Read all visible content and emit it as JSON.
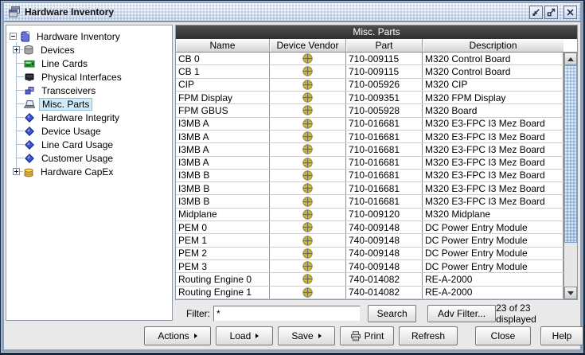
{
  "window": {
    "title": "Hardware Inventory",
    "controls": [
      {
        "name": "minimize"
      },
      {
        "name": "maximize"
      },
      {
        "name": "close"
      }
    ]
  },
  "tree": {
    "items": [
      {
        "label": "Hardware Inventory",
        "icon": "notebook-icon",
        "expander": "minus",
        "level": 0,
        "selected": false
      },
      {
        "label": "Devices",
        "icon": "devices-icon",
        "expander": "plus",
        "level": 1,
        "selected": false
      },
      {
        "label": "Line Cards",
        "icon": "line-card-icon",
        "expander": null,
        "level": 1,
        "selected": false
      },
      {
        "label": "Physical Interfaces",
        "icon": "physical-interface-icon",
        "expander": null,
        "level": 1,
        "selected": false
      },
      {
        "label": "Transceivers",
        "icon": "transceiver-icon",
        "expander": null,
        "level": 1,
        "selected": false
      },
      {
        "label": "Misc. Parts",
        "icon": "laptop-icon",
        "expander": null,
        "level": 1,
        "selected": true
      },
      {
        "label": "Hardware Integrity",
        "icon": "diamond-icon",
        "expander": null,
        "level": 1,
        "selected": false
      },
      {
        "label": "Device Usage",
        "icon": "diamond-icon",
        "expander": null,
        "level": 1,
        "selected": false
      },
      {
        "label": "Line Card Usage",
        "icon": "diamond-icon",
        "expander": null,
        "level": 1,
        "selected": false
      },
      {
        "label": "Customer Usage",
        "icon": "diamond-icon",
        "expander": null,
        "level": 1,
        "selected": false
      },
      {
        "label": "Hardware CapEx",
        "icon": "coins-icon",
        "expander": "plus",
        "level": 1,
        "selected": false
      }
    ]
  },
  "table": {
    "title": "Misc. Parts",
    "columns": [
      "Name",
      "Device Vendor",
      "Part",
      "Description"
    ],
    "vendor_icon": "juniper-logo-icon",
    "rows": [
      {
        "name": "CB 0",
        "part": "710-009115",
        "description": "M320 Control Board"
      },
      {
        "name": "CB 1",
        "part": "710-009115",
        "description": "M320 Control Board"
      },
      {
        "name": "CIP",
        "part": "710-005926",
        "description": "M320 CIP"
      },
      {
        "name": "FPM Display",
        "part": "710-009351",
        "description": "M320 FPM Display"
      },
      {
        "name": "FPM GBUS",
        "part": "710-005928",
        "description": "M320 Board"
      },
      {
        "name": "I3MB A",
        "part": "710-016681",
        "description": "M320 E3-FPC I3 Mez Board"
      },
      {
        "name": "I3MB A",
        "part": "710-016681",
        "description": "M320 E3-FPC I3 Mez Board"
      },
      {
        "name": "I3MB A",
        "part": "710-016681",
        "description": "M320 E3-FPC I3 Mez Board"
      },
      {
        "name": "I3MB A",
        "part": "710-016681",
        "description": "M320 E3-FPC I3 Mez Board"
      },
      {
        "name": "I3MB B",
        "part": "710-016681",
        "description": "M320 E3-FPC I3 Mez Board"
      },
      {
        "name": "I3MB B",
        "part": "710-016681",
        "description": "M320 E3-FPC I3 Mez Board"
      },
      {
        "name": "I3MB B",
        "part": "710-016681",
        "description": "M320 E3-FPC I3 Mez Board"
      },
      {
        "name": "Midplane",
        "part": "710-009120",
        "description": "M320 Midplane"
      },
      {
        "name": "PEM 0",
        "part": "740-009148",
        "description": "DC Power Entry Module"
      },
      {
        "name": "PEM 1",
        "part": "740-009148",
        "description": "DC Power Entry Module"
      },
      {
        "name": "PEM 2",
        "part": "740-009148",
        "description": "DC Power Entry Module"
      },
      {
        "name": "PEM 3",
        "part": "740-009148",
        "description": "DC Power Entry Module"
      },
      {
        "name": "Routing Engine 0",
        "part": "740-014082",
        "description": "RE-A-2000"
      },
      {
        "name": "Routing Engine 1",
        "part": "740-014082",
        "description": "RE-A-2000"
      }
    ]
  },
  "filter": {
    "label": "Filter:",
    "value": "*",
    "search": "Search",
    "adv": "Adv Filter...",
    "status": "23 of 23 displayed"
  },
  "footer": {
    "buttons": [
      {
        "label": "Actions",
        "menu": true
      },
      {
        "label": "Load",
        "menu": true
      },
      {
        "label": "Save",
        "menu": true
      },
      {
        "label": "Print",
        "icon": "printer-icon"
      },
      {
        "label": "Refresh"
      }
    ],
    "right_buttons": [
      {
        "label": "Close"
      },
      {
        "label": "Help"
      }
    ]
  },
  "colors": {
    "selection_bg": "#CFEAF8",
    "table_title_bg": "#3A3A3A",
    "vendor_yellow": "#E7D141",
    "frame_blue": "#8AA2BE"
  }
}
